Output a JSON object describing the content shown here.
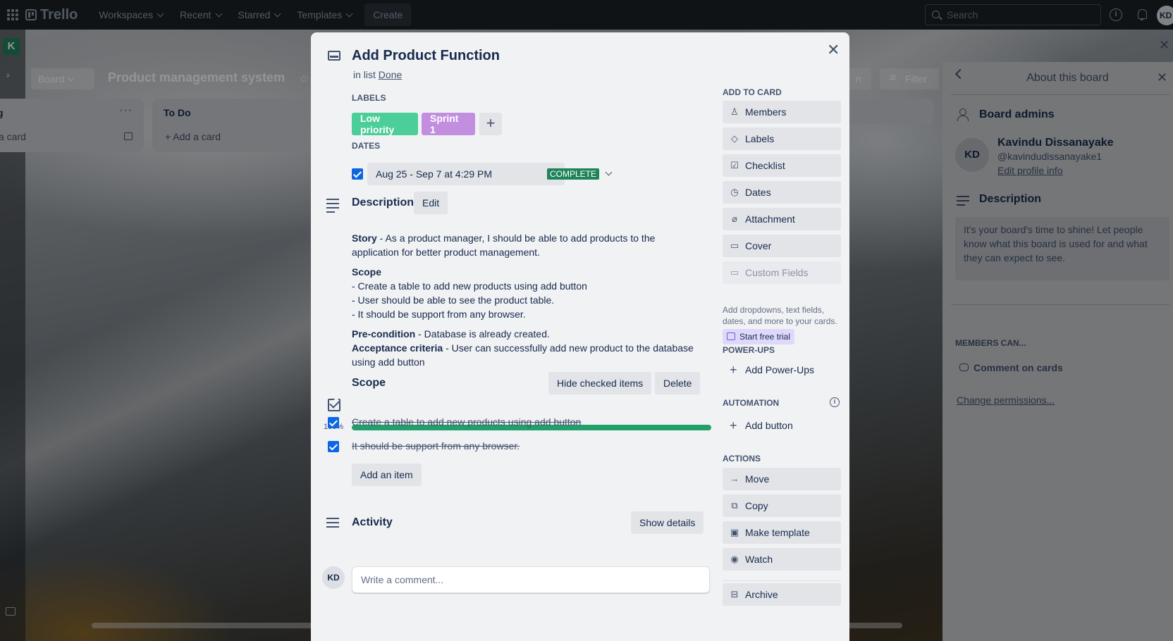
{
  "topbar": {
    "logo": "Trello",
    "nav": [
      "Workspaces",
      "Recent",
      "Starred",
      "Templates"
    ],
    "create": "Create",
    "search_placeholder": "Search",
    "avatar": "KD"
  },
  "board": {
    "workspace_initial": "K",
    "view": "Board",
    "title": "Product management system",
    "filter": "Filter",
    "join_partial": "n",
    "lists": [
      {
        "title": "g",
        "add": "a card"
      },
      {
        "title": "To Do",
        "add": "+ Add a card"
      }
    ]
  },
  "sidepanel": {
    "title": "About this board",
    "admins_heading": "Board admins",
    "admin_initials": "KD",
    "admin_name": "Kavindu Dissanayake",
    "admin_handle": "@kavindudissanayake1",
    "edit_profile": "Edit profile info",
    "description_heading": "Description",
    "description_text": "It's your board's time to shine! Let people know what this board is used for and what they can expect to see.",
    "members_can": "MEMBERS CAN...",
    "comment_on_cards": "Comment on cards",
    "change_permissions": "Change permissions..."
  },
  "card": {
    "title": "Add Product Function",
    "in_list_prefix": "in list",
    "list_name": "Done",
    "labels_heading": "LABELS",
    "labels": [
      {
        "text": "Low priority",
        "color": "#4bce97"
      },
      {
        "text": "Sprint 1",
        "color": "#c28fe0"
      }
    ],
    "dates_heading": "DATES",
    "date_text": "Aug 25 - Sep 7 at 4:29 PM",
    "date_status": "COMPLETE",
    "description_heading": "Description",
    "edit": "Edit",
    "description": {
      "story_label": "Story",
      "story_text": " - As a product manager, I should be able to add products to the application for better product management.",
      "scope_label": "Scope",
      "scope_lines": [
        "- Create a table to add new products using add button",
        "- User should be able to see the product table.",
        "- It should be support from any browser."
      ],
      "precondition_label": "Pre-condition",
      "precondition_text": " - Database is already created.",
      "acceptance_label": "Acceptance criteria",
      "acceptance_text": " - User can successfully add new product to the database using add button"
    },
    "checklist": {
      "title": "Scope",
      "hide_checked": "Hide checked items",
      "delete": "Delete",
      "progress_label": "100%",
      "progress": 1.0,
      "items": [
        {
          "text": "Create a table to add new products using add button",
          "checked": true
        },
        {
          "text": "It should be support from any browser.",
          "checked": true
        }
      ],
      "add_item": "Add an item"
    },
    "activity": {
      "title": "Activity",
      "show_details": "Show details",
      "avatar": "KD",
      "comment_placeholder": "Write a comment..."
    }
  },
  "card_sidebar": {
    "add_to_card_heading": "ADD TO CARD",
    "add_to_card": [
      "Members",
      "Labels",
      "Checklist",
      "Dates",
      "Attachment",
      "Cover",
      "Custom Fields"
    ],
    "custom_fields_note": "Add dropdowns, text fields, dates, and more to your cards.",
    "start_trial": "Start free trial",
    "powerups_heading": "POWER-UPS",
    "add_powerups": "Add Power-Ups",
    "automation_heading": "AUTOMATION",
    "add_button": "Add button",
    "actions_heading": "ACTIONS",
    "actions": [
      "Move",
      "Copy",
      "Make template",
      "Watch",
      "Archive"
    ]
  },
  "colors": {
    "label_green": "#4bce97",
    "label_purple": "#c28fe0",
    "complete_green": "#1f845a",
    "progress_green": "#22a06b",
    "check_blue": "#0c66e4"
  }
}
